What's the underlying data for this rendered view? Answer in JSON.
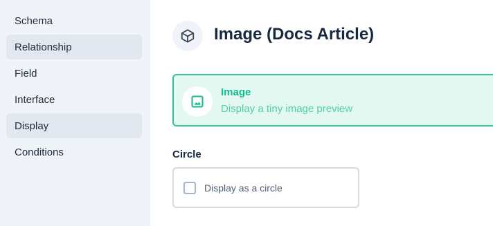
{
  "sidebar": {
    "items": [
      {
        "label": "Schema",
        "active": false
      },
      {
        "label": "Relationship",
        "active": true
      },
      {
        "label": "Field",
        "active": false
      },
      {
        "label": "Interface",
        "active": false
      },
      {
        "label": "Display",
        "active": true
      },
      {
        "label": "Conditions",
        "active": false
      }
    ]
  },
  "header": {
    "icon": "cube-icon",
    "title": "Image (Docs Article)"
  },
  "display_option": {
    "icon": "image-icon",
    "title": "Image",
    "description": "Display a tiny image preview",
    "selected": true
  },
  "options": {
    "circle": {
      "label": "Circle",
      "checkbox_label": "Display as a circle",
      "checked": false
    }
  },
  "colors": {
    "accent": "#17b98e",
    "sidebar_bg": "#f0f4f9",
    "active_item_bg": "#e2e8f0",
    "title_text": "#172940"
  }
}
